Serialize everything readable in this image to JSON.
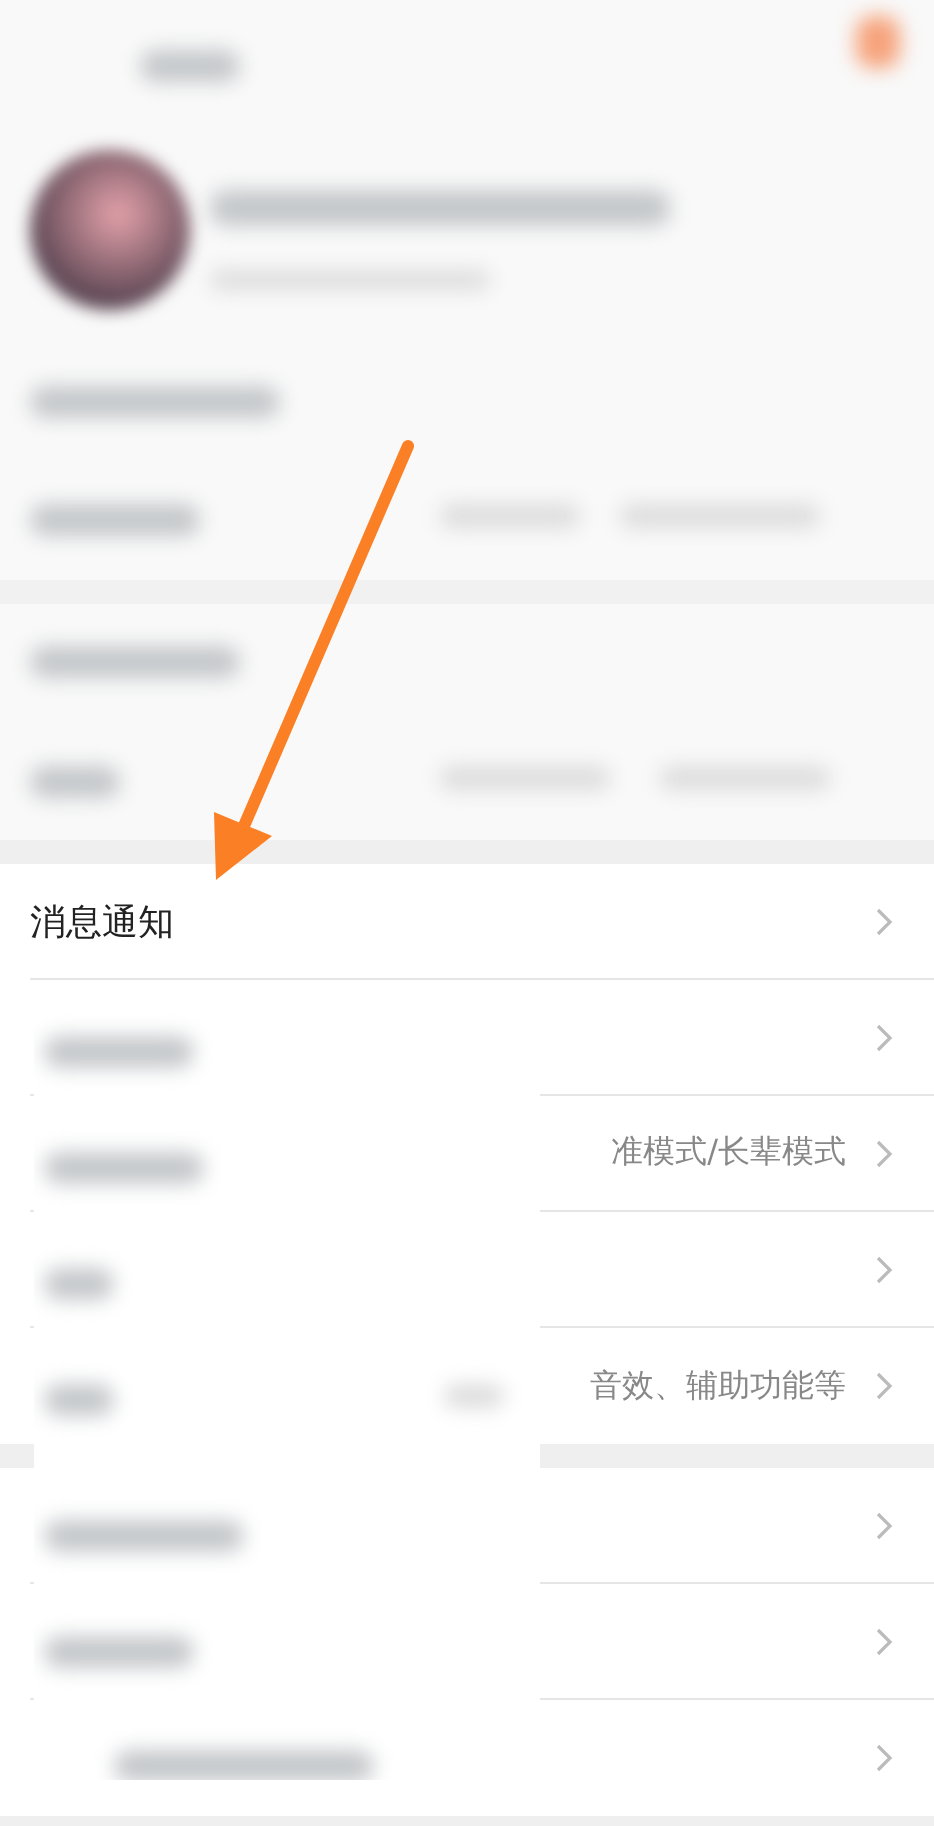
{
  "sections": [
    {
      "rows": [
        {
          "kind": "link",
          "label": "消息通知"
        },
        {
          "kind": "link"
        },
        {
          "kind": "link",
          "value": "准模式/长辈模式"
        },
        {
          "kind": "link"
        },
        {
          "kind": "link",
          "value": "音效、辅助功能等"
        }
      ]
    },
    {
      "rows": [
        {
          "kind": "link"
        },
        {
          "kind": "link"
        },
        {
          "kind": "link"
        }
      ]
    }
  ]
}
